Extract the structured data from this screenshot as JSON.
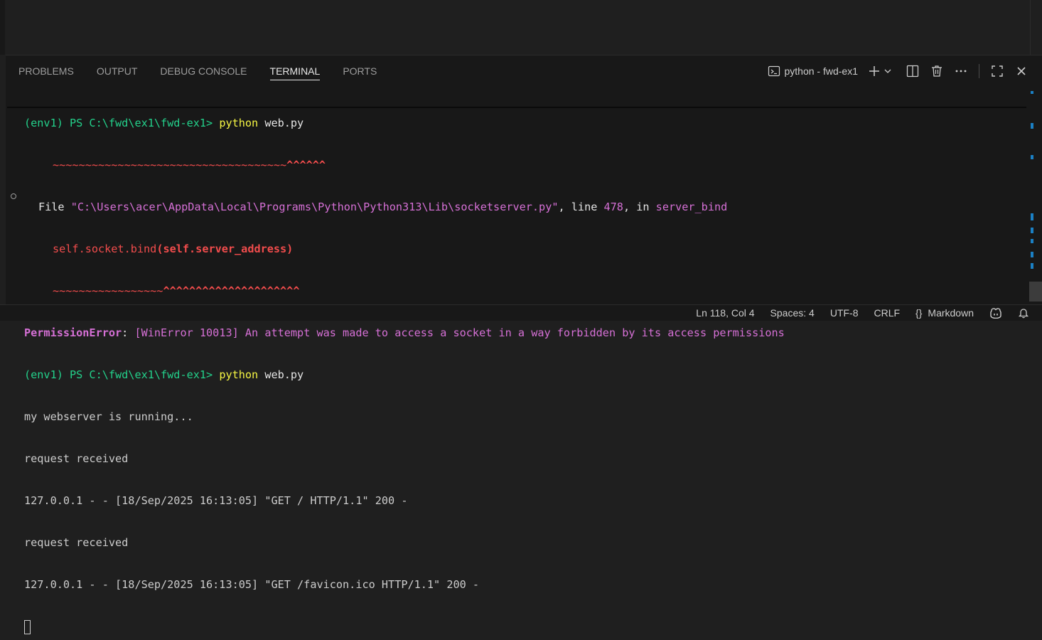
{
  "panel_tabs": [
    "PROBLEMS",
    "OUTPUT",
    "DEBUG CONSOLE",
    "TERMINAL",
    "PORTS"
  ],
  "active_tab": "TERMINAL",
  "terminal_name": "python - fwd-ex1",
  "terminal": {
    "line1_prompt": "(env1) PS C:\\fwd\\ex1\\fwd-ex1> ",
    "line1_cmd": "python",
    "line1_arg": " web.py",
    "line2_tilde": "~~~~~~~~~~~~~~~~~~~~~~~~~~~~~~~~~~~~",
    "line2_caret": "^^^^^^",
    "line3_file": "File ",
    "line3_path": "\"C:\\Users\\acer\\AppData\\Local\\Programs\\Python\\Python313\\Lib\\socketserver.py\"",
    "line3_line": ", line ",
    "line3_num": "478",
    "line3_in": ", in ",
    "line3_func": "server_bind",
    "line4_a": "self.socket.bind",
    "line4_b": "(self.server_address)",
    "line5_tilde": "~~~~~~~~~~~~~~~~~",
    "line5_caret": "^^^^^^^^^^^^^^^^^^^^^",
    "line6_err": "PermissionError",
    "line6_colon": ": ",
    "line6_msg": "[WinError 10013] An attempt was made to access a socket in a way forbidden by its access permissions",
    "line7_prompt": "(env1) PS C:\\fwd\\ex1\\fwd-ex1> ",
    "line7_cmd": "python",
    "line7_arg": " web.py",
    "line8": "my webserver is running...",
    "line9": "request received",
    "line10": "127.0.0.1 - - [18/Sep/2025 16:13:05] \"GET / HTTP/1.1\" 200 -",
    "line11": "request received",
    "line12": "127.0.0.1 - - [18/Sep/2025 16:13:05] \"GET /favicon.ico HTTP/1.1\" 200 -"
  },
  "status_bar": {
    "position": "Ln 118, Col 4",
    "spaces": "Spaces: 4",
    "encoding": "UTF-8",
    "eol": "CRLF",
    "language_braces": "{}",
    "language": "Markdown"
  },
  "colors": {
    "accent_blue": "#1b80c4",
    "error_red": "#f14c4c",
    "magenta": "#d670d6",
    "prompt_green": "#23d18b",
    "command_yellow": "#f5f543"
  }
}
